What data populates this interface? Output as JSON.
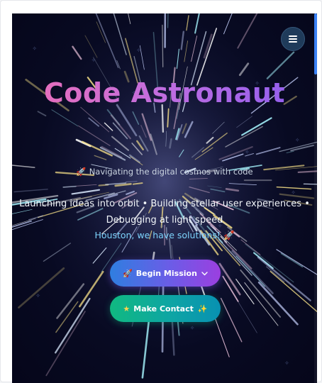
{
  "hero": {
    "title": "Code Astronaut",
    "tagline": "Navigating the digital cosmos with code",
    "description_line1": "Launching ideas into orbit • Building stellar user experiences •",
    "description_line2": "Debugging at light speed",
    "highlight": "Houston, we have solutions!"
  },
  "buttons": {
    "primary_label": "Begin Mission",
    "secondary_label": "Make Contact"
  },
  "icons": {
    "menu": "hamburger-icon",
    "tagline": "rocket-icon",
    "highlight": "rocket-icon",
    "primary": "rocket-icon",
    "primary_after": "chevron-down-icon",
    "secondary": "star-icon",
    "secondary_after": "sparkle-icon"
  },
  "colors": {
    "background": "#080a22",
    "title_gradient_start": "#ee6fb5",
    "title_gradient_end": "#8a5cf0",
    "highlight": "#7dd3fc",
    "primary_button_start": "#2f7ee0",
    "primary_button_end": "#9b3fe0",
    "secondary_button_start": "#10b981",
    "secondary_button_end": "#0891b2",
    "scroll_thumb": "#3b82f6"
  }
}
